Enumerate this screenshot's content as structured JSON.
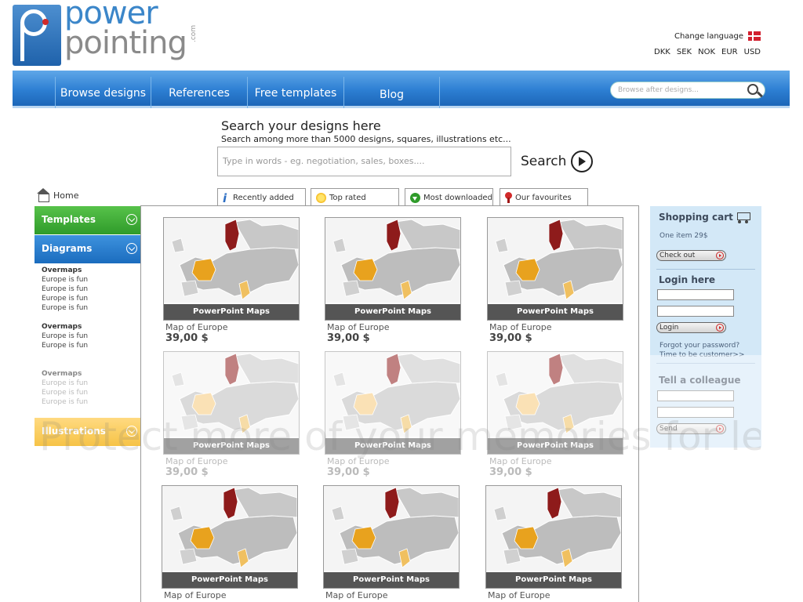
{
  "brand": {
    "line1": "power",
    "line2": "pointing",
    "suffix": ".com"
  },
  "header": {
    "change_language": "Change language",
    "currencies": [
      "DKK",
      "SEK",
      "NOK",
      "EUR",
      "USD"
    ]
  },
  "nav": {
    "items": [
      "Browse designs",
      "References",
      "Free templates",
      "Blog"
    ],
    "search_placeholder": "Browse after designs..."
  },
  "search": {
    "title": "Search your designs here",
    "subtitle": "Search among more than 5000 designs, squares, illustrations etc...",
    "placeholder": "Type in words - eg. negotiation, sales, boxes....",
    "button": "Search"
  },
  "sidebar": {
    "home": "Home",
    "categories": {
      "templates": "Templates",
      "diagrams": "Diagrams",
      "illustrations": "Illustrations"
    },
    "groups": [
      {
        "heading": "Overmaps",
        "items": [
          "Europe is fun",
          "Europe is fun",
          "Europe is fun",
          "Europe is fun"
        ]
      },
      {
        "heading": "Overmaps",
        "items": [
          "Europe is fun",
          "Europe is fun"
        ]
      },
      {
        "heading": "Overmaps",
        "items": [
          "Europe is fun",
          "Europe is fun",
          "Europe is fun"
        ]
      }
    ]
  },
  "tabs": [
    {
      "label": "Recently added",
      "icon": "info-icon",
      "active": true
    },
    {
      "label": "Top rated",
      "icon": "star-icon"
    },
    {
      "label": "Most downloaded",
      "icon": "download-icon"
    },
    {
      "label": "Our favourites",
      "icon": "ribbon-icon"
    }
  ],
  "products": [
    {
      "caption": "PowerPoint Maps",
      "name": "Map of Europe",
      "price": "39,00 $"
    },
    {
      "caption": "PowerPoint Maps",
      "name": "Map of Europe",
      "price": "39,00 $"
    },
    {
      "caption": "PowerPoint Maps",
      "name": "Map of Europe",
      "price": "39,00 $"
    },
    {
      "caption": "PowerPoint Maps",
      "name": "Map of Europe",
      "price": "39,00 $"
    },
    {
      "caption": "PowerPoint Maps",
      "name": "Map of Europe",
      "price": "39,00 $"
    },
    {
      "caption": "PowerPoint Maps",
      "name": "Map of Europe",
      "price": "39,00 $"
    },
    {
      "caption": "PowerPoint Maps",
      "name": "Map of Europe",
      "price": ""
    },
    {
      "caption": "PowerPoint Maps",
      "name": "Map of Europe",
      "price": ""
    },
    {
      "caption": "PowerPoint Maps",
      "name": "Map of Europe",
      "price": ""
    }
  ],
  "cart": {
    "title": "Shopping cart",
    "items": "One item 29$",
    "checkout": "Check out",
    "login_title": "Login here",
    "login_button": "Login",
    "forgot": "Forgot your password?",
    "new_customer": "Time to be customer>>",
    "tell_title": "Tell a colleague",
    "send": "Send"
  },
  "watermark": "Protect more of your memories for less!",
  "colors": {
    "nav": "#2d7fd3",
    "templates": "#3aa734",
    "diagrams": "#2a7fd0",
    "illustrations": "#f5b927",
    "sidebar_right": "#d3e8f7"
  }
}
